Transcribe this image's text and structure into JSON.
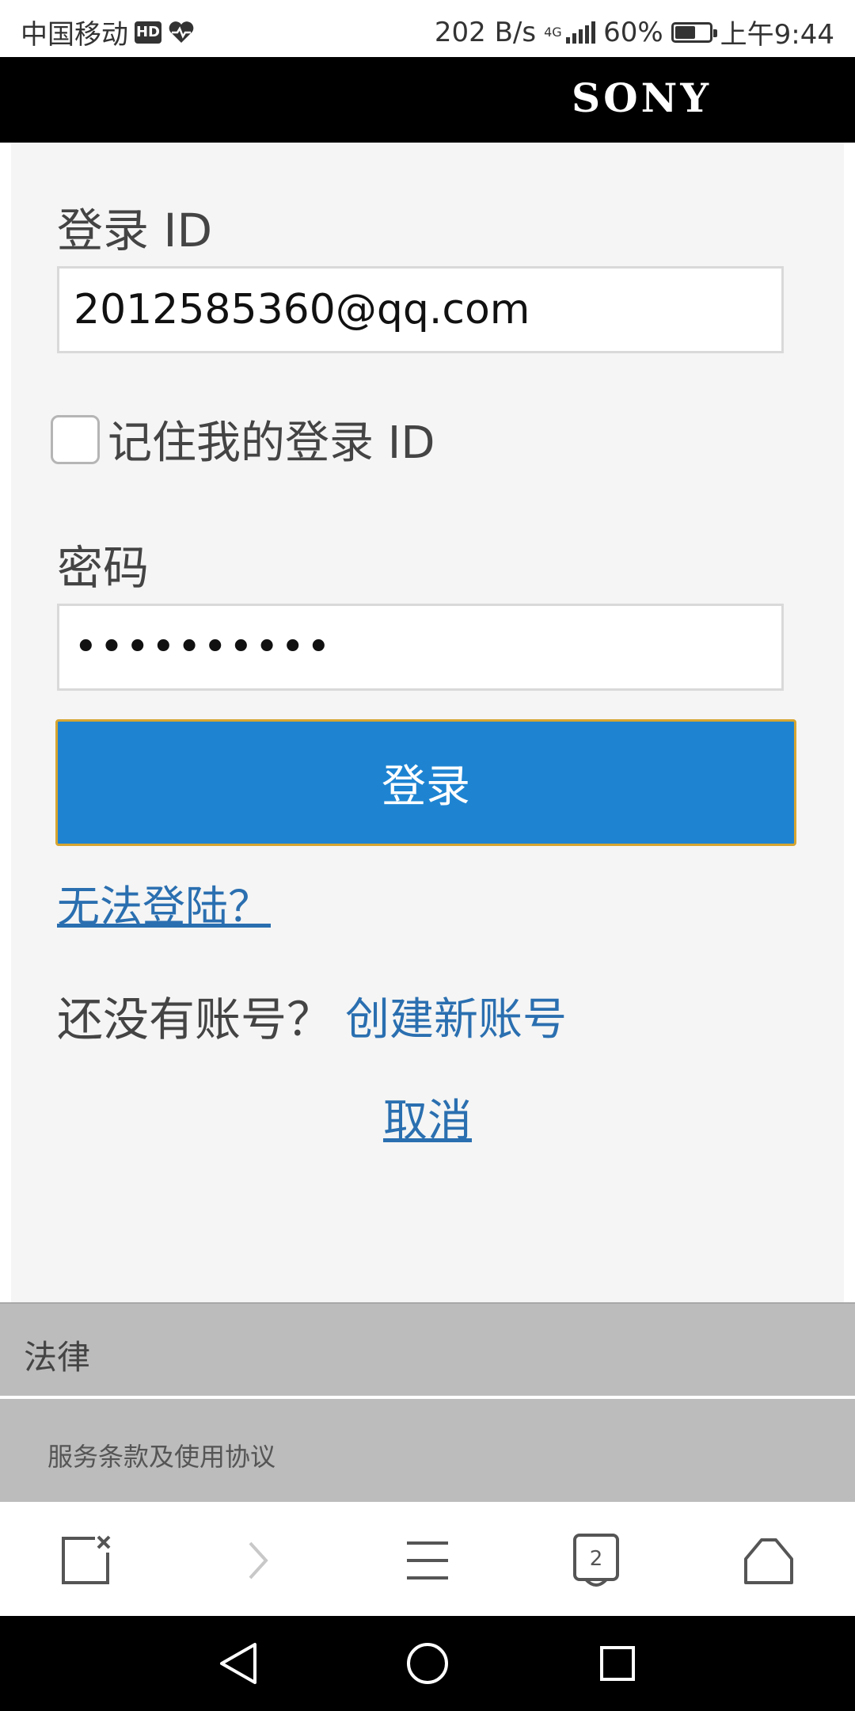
{
  "status_bar": {
    "carrier": "中国移动",
    "hd": "HD",
    "speed": "202 B/s",
    "network_type": "4G",
    "battery": "60%",
    "battery_level": 0.6,
    "time": "上午9:44"
  },
  "header": {
    "brand": "SONY"
  },
  "form": {
    "login_id_label": "登录 ID",
    "login_id_value": "2012585360@qq.com",
    "remember_label": "记住我的登录 ID",
    "remember_checked": false,
    "password_label": "密码",
    "password_value": "••••••••••",
    "login_button": "登录",
    "forgot_link": "无法登陆？",
    "no_account_text": "还没有账号？",
    "create_account_link": "创建新账号",
    "cancel_link": "取消"
  },
  "footer": {
    "legal_title": "法律",
    "terms_link": "服务条款及使用协议"
  },
  "browser_toolbar": {
    "tab_count": "2",
    "icons": [
      "close-page-icon",
      "forward-icon",
      "menu-icon",
      "tabs-icon",
      "home-icon"
    ]
  },
  "android_nav": {
    "icons": [
      "back-icon",
      "home-circle-icon",
      "recents-icon"
    ]
  },
  "colors": {
    "accent": "#1e84d2",
    "link": "#2a6fb0",
    "button_border": "#d6a531",
    "header_bg": "#000000"
  }
}
